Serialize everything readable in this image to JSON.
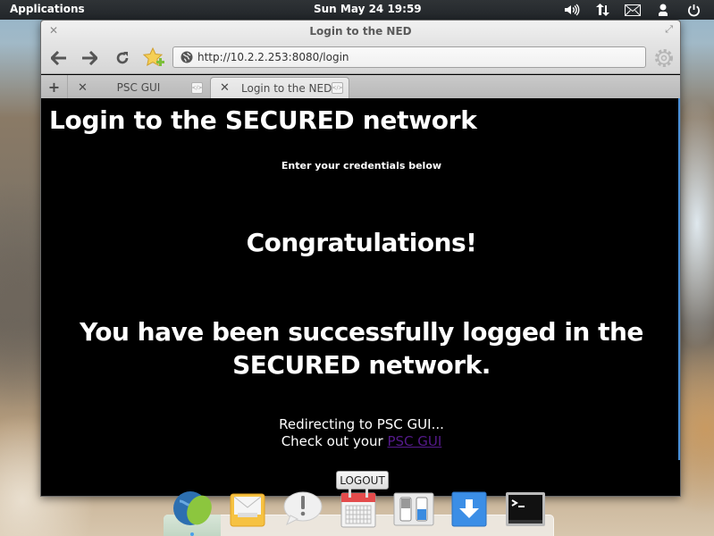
{
  "panel": {
    "applications_label": "Applications",
    "clock": "Sun May 24 19:59",
    "indicators": [
      "volume-icon",
      "network-icon",
      "mail-icon",
      "user-icon",
      "power-icon"
    ]
  },
  "window": {
    "title": "Login to the NED",
    "url": "http://10.2.2.253:8080/login",
    "tabs": [
      {
        "label": "PSC GUI",
        "active": false
      },
      {
        "label": "Login to the NED",
        "active": true
      }
    ]
  },
  "page": {
    "heading": "Login to the SECURED network",
    "subheading": "Enter your credentials below",
    "congrats": "Congratulations!",
    "success_line1": "You have been successfully logged in the",
    "success_line2": "SECURED network.",
    "redirect_text": "Redirecting to PSC GUI...",
    "checkout_prefix": "Check out your ",
    "checkout_link": "PSC GUI",
    "logout_label": "LOGOUT"
  },
  "dock": {
    "items": [
      "web-browser",
      "mail",
      "notifications",
      "calendar",
      "settings",
      "downloads",
      "terminal"
    ]
  },
  "colors": {
    "link": "#551a8b",
    "accent": "#4a90d9",
    "panel_bg": "#2a2e31"
  }
}
